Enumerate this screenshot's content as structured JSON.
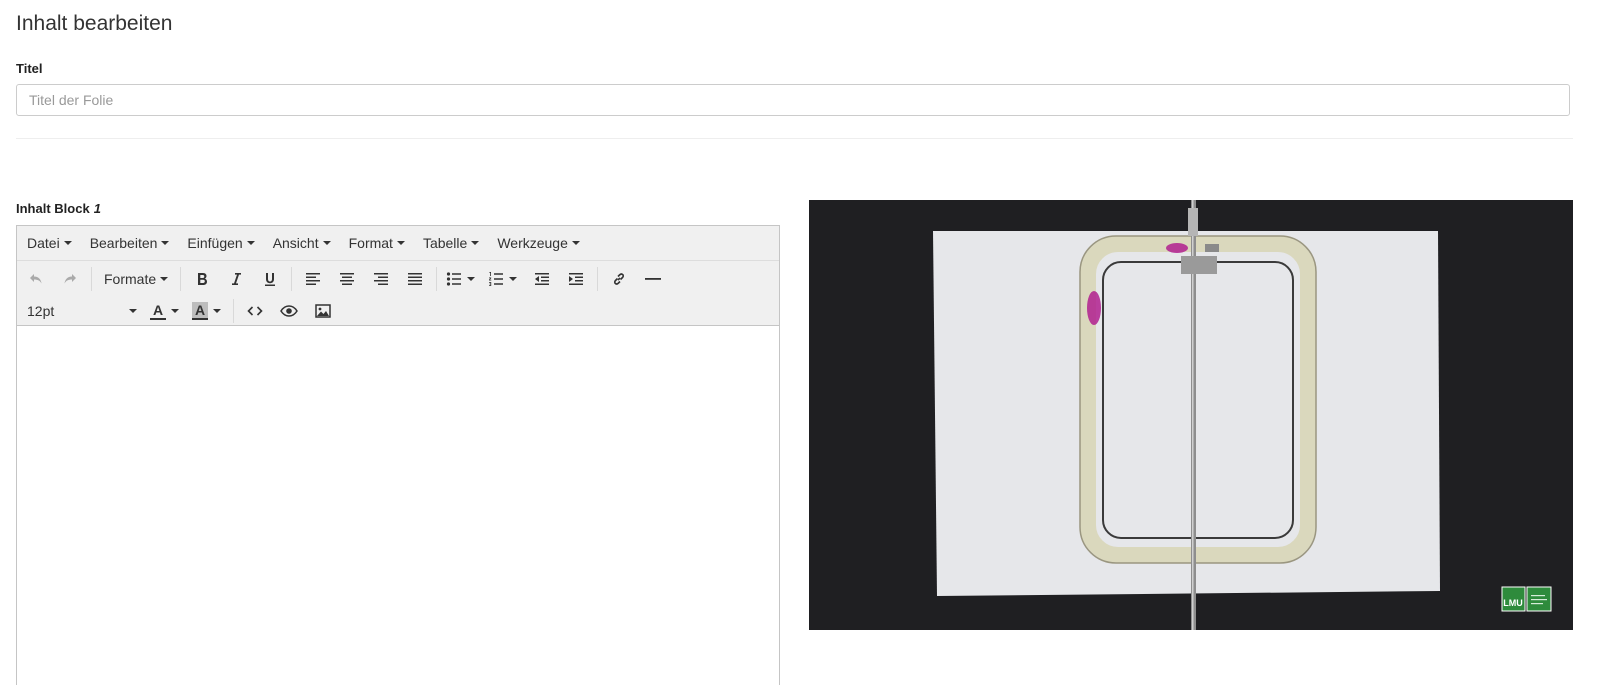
{
  "page": {
    "title": "Inhalt bearbeiten"
  },
  "title_field": {
    "label": "Titel",
    "placeholder": "Titel der Folie",
    "value": ""
  },
  "block": {
    "label": "Inhalt Block",
    "number": "1"
  },
  "editor": {
    "menubar": [
      "Datei",
      "Bearbeiten",
      "Einfügen",
      "Ansicht",
      "Format",
      "Tabelle",
      "Werkzeuge"
    ],
    "formats_label": "Formate",
    "font_size": "12pt",
    "text_color_glyph": "A",
    "bg_color_glyph": "A",
    "content": ""
  },
  "image": {
    "logo_text": "LMU",
    "colors": {
      "background": "#1f1f22",
      "paper": "#e6e7ea",
      "tube": "#d8d6b8",
      "dye": "#b0208f",
      "logo": "#2e8b3c"
    }
  },
  "icons": {
    "undo": "undo-icon",
    "redo": "redo-icon",
    "bold": "bold-icon",
    "italic": "italic-icon",
    "underline": "underline-icon",
    "align_left": "align-left-icon",
    "align_center": "align-center-icon",
    "align_right": "align-right-icon",
    "align_justify": "align-justify-icon",
    "bullet_list": "bullet-list-icon",
    "numbered_list": "numbered-list-icon",
    "outdent": "outdent-icon",
    "indent": "indent-icon",
    "link": "link-icon",
    "horizontal_rule": "horizontal-rule-icon",
    "text_color": "text-color-icon",
    "background_color": "background-color-icon",
    "source_code": "source-code-icon",
    "preview": "preview-icon",
    "insert_image": "insert-image-icon"
  }
}
